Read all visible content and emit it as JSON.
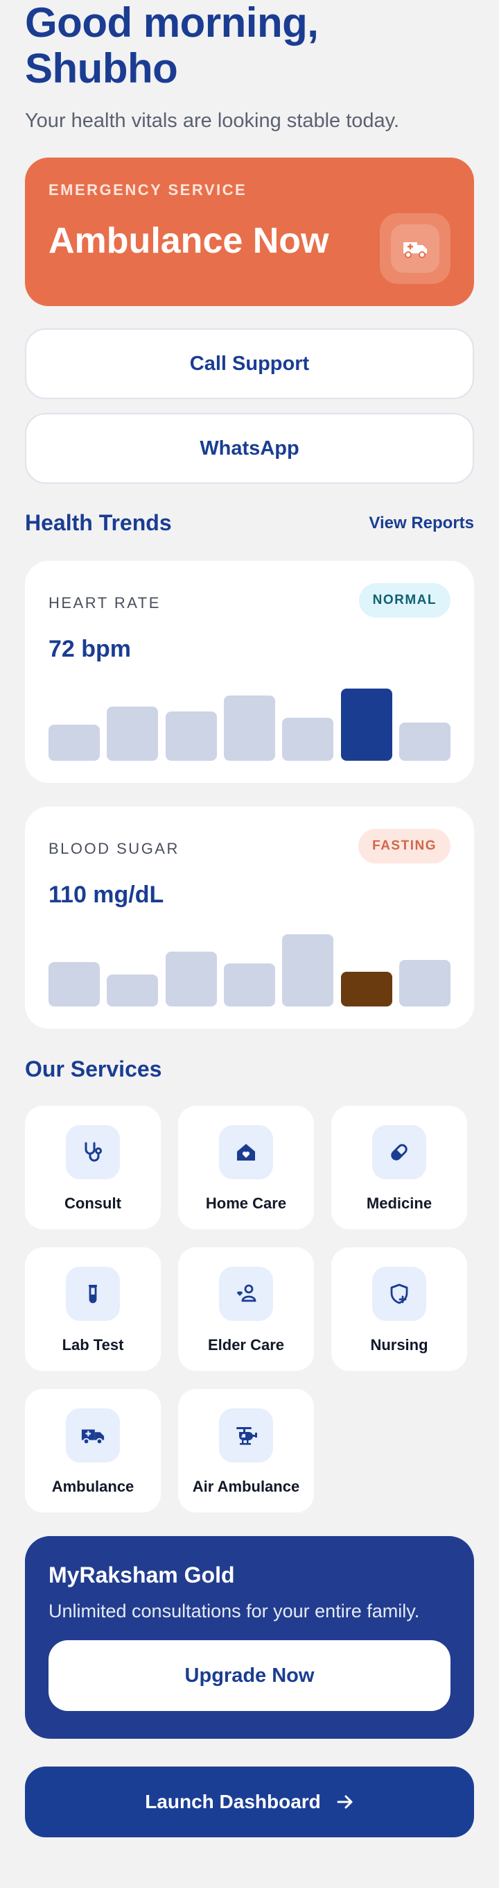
{
  "greeting": {
    "line1": "Good morning,",
    "line2": "Shubho",
    "subtitle": "Your health vitals are looking stable today."
  },
  "emergency": {
    "eyebrow": "EMERGENCY SERVICE",
    "title": "Ambulance Now",
    "icon": "ambulance-icon",
    "color": "#e86f4b"
  },
  "contact": {
    "call_label": "Call Support",
    "whatsapp_label": "WhatsApp"
  },
  "trends": {
    "title": "Health Trends",
    "link": "View Reports",
    "heart_rate": {
      "label": "HEART RATE",
      "value": "72 bpm",
      "badge": "NORMAL",
      "bars": [
        0.5,
        0.75,
        0.68,
        0.9,
        0.6,
        1.0,
        0.53
      ],
      "highlight_index": 5,
      "highlight_color": "#1a3d92"
    },
    "blood_sugar": {
      "label": "BLOOD SUGAR",
      "value": "110 mg/dL",
      "badge": "FASTING",
      "bars": [
        0.62,
        0.44,
        0.76,
        0.6,
        1.0,
        0.48,
        0.64
      ],
      "highlight_index": 5,
      "highlight_color": "#6a3b0e"
    }
  },
  "services": {
    "title": "Our Services",
    "items": [
      {
        "label": "Consult",
        "icon": "stethoscope-icon"
      },
      {
        "label": "Home Care",
        "icon": "home-care-icon"
      },
      {
        "label": "Medicine",
        "icon": "pill-icon"
      },
      {
        "label": "Lab Test",
        "icon": "test-tube-icon"
      },
      {
        "label": "Elder Care",
        "icon": "elder-care-icon"
      },
      {
        "label": "Nursing",
        "icon": "shield-plus-icon"
      },
      {
        "label": "Ambulance",
        "icon": "ambulance-icon"
      },
      {
        "label": "Air Ambulance",
        "icon": "helicopter-icon"
      }
    ]
  },
  "gold": {
    "title": "MyRaksham Gold",
    "description": "Unlimited consultations for your entire family.",
    "button": "Upgrade Now"
  },
  "launch": {
    "label": "Launch Dashboard",
    "icon": "arrow-right-icon"
  },
  "colors": {
    "primary": "#1a3d92",
    "background": "#f2f2f3",
    "gold_card": "#223d8f"
  }
}
